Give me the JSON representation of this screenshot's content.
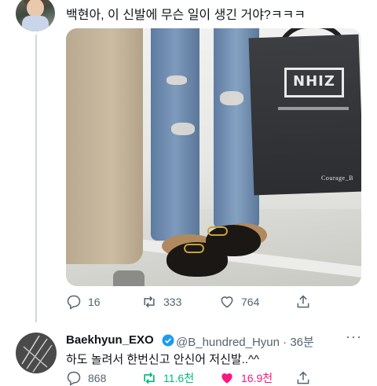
{
  "tweet": {
    "text": "백현아, 이 신발에 무슨 일이 생긴 거야?ㅋㅋㅋ",
    "photo": {
      "bag_logo": "NHIZ",
      "watermark": "Courage_B"
    },
    "actions": {
      "replies": "16",
      "retweets": "333",
      "likes": "764"
    }
  },
  "reply": {
    "display_name": "Baekhyun_EXO",
    "handle": "@B_hundred_Hyun",
    "separator": "·",
    "time": "36분",
    "text": "하도 놀려서 한번신고 안신어 저신발..^^",
    "actions": {
      "replies": "868",
      "retweets": "11.6천",
      "likes": "16.9천"
    }
  },
  "colors": {
    "retweet_active": "#00ba7c",
    "like_active": "#f91880",
    "verified": "#1d9bf0",
    "muted": "#536471"
  }
}
